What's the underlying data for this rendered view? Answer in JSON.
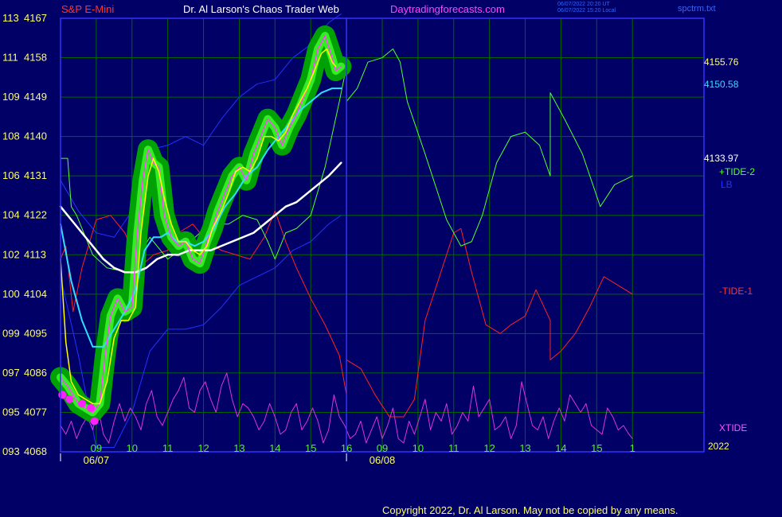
{
  "header": {
    "instrument": "S&P E-Mini",
    "site_title": "Dr. Al Larson's Chaos Trader Web",
    "website": "Daytradingforecasts.com",
    "timestamp_ut": "06/07/2022 20:20 UT",
    "timestamp_local": "06/07/2022 15:20 Local",
    "file_name": "spctrm.txt"
  },
  "footer": {
    "copyright": "Copyright 2022, Dr. Al Larson. May not be copied by any means."
  },
  "right_labels": {
    "price_last": "4155.76",
    "cyan_value": "4150.58",
    "white_value": "4133.97",
    "tide2": "+TIDE-2",
    "lb": "LB",
    "tide1": "-TIDE-1",
    "xtide": "XTIDE",
    "year": "2022"
  },
  "colors": {
    "background": "#000066",
    "grid": "#006600",
    "frame": "#3333ff",
    "price": "#ff44ff",
    "halo": "#00aa00",
    "ma_fast": "#ffff00",
    "ma_mid": "#33ddff",
    "ma_slow": "#ffffff",
    "band": "#2233ff",
    "tide2": "#55ff33",
    "tide1": "#ff2222",
    "xtide": "#dd33dd"
  },
  "chart_data": {
    "type": "line",
    "y_axis": {
      "ticks": [
        {
          "left": "113",
          "right": "4167",
          "value": 4167
        },
        {
          "left": "111",
          "right": "4158",
          "value": 4158
        },
        {
          "left": "109",
          "right": "4149",
          "value": 4149
        },
        {
          "left": "108",
          "right": "4140",
          "value": 4140
        },
        {
          "left": "106",
          "right": "4131",
          "value": 4131
        },
        {
          "left": "104",
          "right": "4122",
          "value": 4122
        },
        {
          "left": "102",
          "right": "4113",
          "value": 4113
        },
        {
          "left": "100",
          "right": "4104",
          "value": 4104
        },
        {
          "left": "099",
          "right": "4095",
          "value": 4095
        },
        {
          "left": "097",
          "right": "4086",
          "value": 4086
        },
        {
          "left": "095",
          "right": "4077",
          "value": 4077
        },
        {
          "left": "093",
          "right": "4068",
          "value": 4068
        }
      ],
      "ylim": [
        4068,
        4167
      ]
    },
    "x_axis": {
      "xlim": [
        8,
        26
      ],
      "hour_ticks": [
        {
          "label": "09",
          "x": 9
        },
        {
          "label": "10",
          "x": 10
        },
        {
          "label": "11",
          "x": 11
        },
        {
          "label": "12",
          "x": 12
        },
        {
          "label": "13",
          "x": 13
        },
        {
          "label": "14",
          "x": 14
        },
        {
          "label": "15",
          "x": 15
        },
        {
          "label": "16",
          "x": 16
        },
        {
          "label": "09",
          "x": 17
        },
        {
          "label": "10",
          "x": 18
        },
        {
          "label": "11",
          "x": 19
        },
        {
          "label": "12",
          "x": 20
        },
        {
          "label": "13",
          "x": 21
        },
        {
          "label": "14",
          "x": 22
        },
        {
          "label": "15",
          "x": 23
        },
        {
          "label": "1",
          "x": 24
        }
      ],
      "date_ticks": [
        {
          "label": "06/07",
          "x": 9
        },
        {
          "label": "06/08",
          "x": 17
        }
      ],
      "day_divider_x": 16
    },
    "series": [
      {
        "key": "price",
        "x": [
          8.0,
          8.2,
          8.35,
          8.5,
          8.7,
          8.9,
          9.1,
          9.25,
          9.4,
          9.6,
          9.8,
          10.0,
          10.15,
          10.3,
          10.45,
          10.6,
          10.75,
          10.9,
          11.1,
          11.3,
          11.5,
          11.7,
          11.9,
          12.1,
          12.25,
          12.4,
          12.6,
          12.8,
          13.0,
          13.2,
          13.4,
          13.6,
          13.8,
          14.0,
          14.2,
          14.4,
          14.6,
          14.8,
          15.0,
          15.2,
          15.4,
          15.6,
          15.7,
          15.85
        ],
        "y": [
          4085,
          4083,
          4081,
          4079,
          4078,
          4077,
          4079,
          4090,
          4099,
          4103,
          4100,
          4101,
          4118,
          4130,
          4137,
          4134,
          4133,
          4122,
          4117,
          4115,
          4116,
          4112,
          4111,
          4116,
          4119,
          4123,
          4127,
          4131,
          4133,
          4130,
          4136,
          4140,
          4144,
          4142,
          4138,
          4142,
          4145,
          4149,
          4153,
          4160,
          4163,
          4158,
          4155,
          4156
        ]
      },
      {
        "key": "ma_fast",
        "x": [
          8.0,
          8.15,
          8.3,
          8.5,
          8.7,
          8.9,
          9.1,
          9.3,
          9.5,
          9.7,
          9.9,
          10.1,
          10.25,
          10.45,
          10.6,
          10.75,
          10.9,
          11.1,
          11.3,
          11.5,
          11.7,
          11.9,
          12.1,
          12.25,
          12.5,
          12.7,
          12.9,
          13.1,
          13.3,
          13.5,
          13.7,
          13.9,
          14.1,
          14.3,
          14.5,
          14.7,
          14.9,
          15.1,
          15.3,
          15.45,
          15.6,
          15.7
        ],
        "y": [
          4112,
          4093,
          4084,
          4081,
          4080,
          4079,
          4079,
          4084,
          4094,
          4098,
          4098,
          4101,
          4118,
          4131,
          4135,
          4132,
          4126,
          4120,
          4116,
          4116,
          4114,
          4113,
          4115,
          4119,
          4123,
          4127,
          4132,
          4133,
          4132,
          4135,
          4140,
          4140,
          4139,
          4141,
          4145,
          4148,
          4151,
          4155,
          4159,
          4160,
          4157,
          4156
        ]
      },
      {
        "key": "ma_mid",
        "x": [
          8.0,
          8.3,
          8.6,
          8.9,
          9.2,
          9.5,
          9.8,
          10.1,
          10.35,
          10.6,
          10.8,
          11.0,
          11.25,
          11.5,
          11.75,
          12.0,
          12.3,
          12.6,
          12.9,
          13.2,
          13.5,
          13.8,
          14.1,
          14.4,
          14.7,
          15.0,
          15.3,
          15.6,
          15.85
        ],
        "y": [
          4120,
          4107,
          4098,
          4092,
          4092,
          4096,
          4100,
          4105,
          4114,
          4117,
          4117,
          4118,
          4116,
          4116,
          4115,
          4116,
          4119,
          4124,
          4127,
          4131,
          4133,
          4137,
          4140,
          4143,
          4146,
          4148,
          4150,
          4151,
          4151
        ]
      },
      {
        "key": "ma_slow",
        "x": [
          8.0,
          8.3,
          8.6,
          8.9,
          9.2,
          9.5,
          9.8,
          10.1,
          10.4,
          10.7,
          11.0,
          11.3,
          11.6,
          11.9,
          12.2,
          12.5,
          12.8,
          13.1,
          13.4,
          13.7,
          14.0,
          14.3,
          14.6,
          14.9,
          15.2,
          15.5,
          15.85
        ],
        "y": [
          4124,
          4121,
          4118,
          4115,
          4112,
          4110,
          4109,
          4109,
          4110,
          4112,
          4113,
          4113,
          4114,
          4114,
          4114,
          4115,
          4116,
          4117,
          4118,
          4120,
          4122,
          4124,
          4125,
          4127,
          4129,
          4131,
          4134
        ]
      },
      {
        "key": "band_upper",
        "x": [
          8.0,
          8.5,
          9.0,
          9.5,
          10.0,
          10.5,
          11.0,
          11.5,
          12.0,
          12.5,
          13.0,
          13.5,
          14.0,
          14.5,
          15.0,
          15.5,
          15.85
        ],
        "y": [
          4130,
          4123,
          4118,
          4117,
          4123,
          4137,
          4138,
          4140,
          4138,
          4144,
          4149,
          4152,
          4153,
          4158,
          4161,
          4166,
          4168
        ]
      },
      {
        "key": "band_lower",
        "x": [
          8.0,
          8.5,
          9.0,
          9.5,
          10.0,
          10.5,
          11.0,
          11.5,
          12.0,
          12.5,
          13.0,
          13.5,
          14.0,
          14.5,
          15.0,
          15.5,
          15.85
        ],
        "y": [
          4108,
          4090,
          4069,
          4069,
          4077,
          4091,
          4096,
          4096,
          4097,
          4101,
          4106,
          4108,
          4110,
          4114,
          4116,
          4120,
          4122
        ]
      },
      {
        "key": "tide2",
        "x": [
          8.0,
          8.2,
          8.3,
          8.45,
          8.9,
          9.3,
          9.9,
          10.5,
          11.0,
          11.5,
          11.9,
          12.3,
          12.7,
          13.1,
          13.5,
          13.8,
          14.0,
          14.3,
          14.6,
          15.0,
          15.4,
          15.8,
          16.0,
          16.0,
          16.3,
          16.6,
          17.0,
          17.3,
          17.5,
          17.7,
          18.2,
          18.8,
          19.2,
          19.5,
          19.8,
          20.2,
          20.6,
          21.0,
          21.4,
          21.7,
          21.7,
          22.1,
          22.6,
          23.1,
          23.5,
          24.0
        ],
        "y": [
          4135,
          4135,
          4124,
          4122,
          4113,
          4110,
          4109,
          4117,
          4112,
          4115,
          4118,
          4120,
          4120,
          4122,
          4121,
          4116,
          4112,
          4118,
          4119,
          4122,
          4133,
          4148,
          4156,
          4148,
          4151,
          4157,
          4158,
          4160,
          4157,
          4148,
          4136,
          4121,
          4115,
          4116,
          4122,
          4134,
          4140,
          4141,
          4138,
          4131,
          4150,
          4144,
          4136,
          4124,
          4129,
          4131
        ]
      },
      {
        "key": "tide1",
        "x": [
          8.0,
          8.15,
          8.35,
          8.6,
          9.0,
          9.4,
          9.8,
          10.2,
          10.6,
          11.0,
          11.3,
          11.7,
          12.1,
          12.5,
          12.9,
          13.3,
          13.7,
          14.0,
          14.3,
          14.6,
          15.0,
          15.4,
          15.8,
          16.0,
          16.0,
          16.4,
          16.8,
          17.2,
          17.6,
          17.9,
          18.2,
          18.6,
          19.0,
          19.2,
          19.5,
          19.9,
          20.3,
          20.6,
          21.0,
          21.3,
          21.7,
          21.7,
          22.0,
          22.4,
          22.8,
          23.2,
          23.6,
          24.0
        ],
        "y": [
          4112,
          4115,
          4100,
          4110,
          4121,
          4122,
          4118,
          4110,
          4113,
          4114,
          4118,
          4120,
          4116,
          4114,
          4113,
          4112,
          4117,
          4123,
          4116,
          4110,
          4103,
          4097,
          4090,
          4081,
          4089,
          4087,
          4081,
          4076,
          4076,
          4080,
          4098,
          4108,
          4118,
          4119,
          4109,
          4097,
          4095,
          4097,
          4099,
          4105,
          4098,
          4089,
          4091,
          4095,
          4101,
          4108,
          4106,
          4104
        ]
      },
      {
        "key": "xtide",
        "x": [
          8.0,
          8.15,
          8.3,
          8.45,
          8.6,
          8.75,
          8.9,
          9.05,
          9.2,
          9.35,
          9.5,
          9.65,
          9.8,
          9.95,
          10.1,
          10.25,
          10.4,
          10.55,
          10.7,
          10.85,
          11.0,
          11.15,
          11.3,
          11.45,
          11.6,
          11.75,
          11.9,
          12.05,
          12.2,
          12.35,
          12.5,
          12.65,
          12.8,
          12.95,
          13.1,
          13.25,
          13.4,
          13.55,
          13.7,
          13.85,
          14.0,
          14.15,
          14.3,
          14.45,
          14.6,
          14.75,
          14.9,
          15.05,
          15.2,
          15.35,
          15.5,
          15.65,
          15.8,
          15.95,
          16.1,
          16.25,
          16.4,
          16.55,
          16.7,
          16.85,
          17.0,
          17.15,
          17.3,
          17.45,
          17.6,
          17.75,
          17.9,
          18.05,
          18.2,
          18.35,
          18.5,
          18.65,
          18.8,
          18.95,
          19.1,
          19.25,
          19.4,
          19.55,
          19.7,
          19.85,
          20.0,
          20.15,
          20.3,
          20.45,
          20.6,
          20.75,
          20.9,
          21.05,
          21.2,
          21.35,
          21.5,
          21.65,
          21.8,
          21.95,
          22.1,
          22.25,
          22.4,
          22.55,
          22.7,
          22.85,
          23.0,
          23.15,
          23.3,
          23.45,
          23.6,
          23.75,
          23.9,
          24.0
        ],
        "y": [
          4074,
          4072,
          4075,
          4071,
          4074,
          4076,
          4073,
          4078,
          4072,
          4070,
          4075,
          4079,
          4075,
          4078,
          4076,
          4073,
          4079,
          4082,
          4076,
          4074,
          4077,
          4080,
          4082,
          4085,
          4078,
          4077,
          4082,
          4084,
          4080,
          4077,
          4083,
          4086,
          4080,
          4076,
          4079,
          4078,
          4076,
          4073,
          4075,
          4079,
          4076,
          4072,
          4073,
          4077,
          4079,
          4073,
          4075,
          4078,
          4075,
          4070,
          4073,
          4081,
          4076,
          4074,
          4071,
          4072,
          4075,
          4070,
          4073,
          4076,
          4071,
          4074,
          4078,
          4071,
          4070,
          4075,
          4072,
          4076,
          4080,
          4073,
          4077,
          4075,
          4079,
          4072,
          4074,
          4077,
          4075,
          4083,
          4076,
          4078,
          4080,
          4073,
          4074,
          4076,
          4071,
          4074,
          4084,
          4079,
          4074,
          4073,
          4076,
          4071,
          4075,
          4078,
          4075,
          4081,
          4079,
          4077,
          4079,
          4074,
          4073,
          4072,
          4078,
          4076,
          4073,
          4074,
          4072,
          4071
        ]
      }
    ],
    "extreme_markers": {
      "x": [
        8.05,
        8.25,
        8.6,
        8.85,
        8.95
      ],
      "y": [
        4081,
        4080,
        4079,
        4078,
        4075
      ]
    }
  }
}
